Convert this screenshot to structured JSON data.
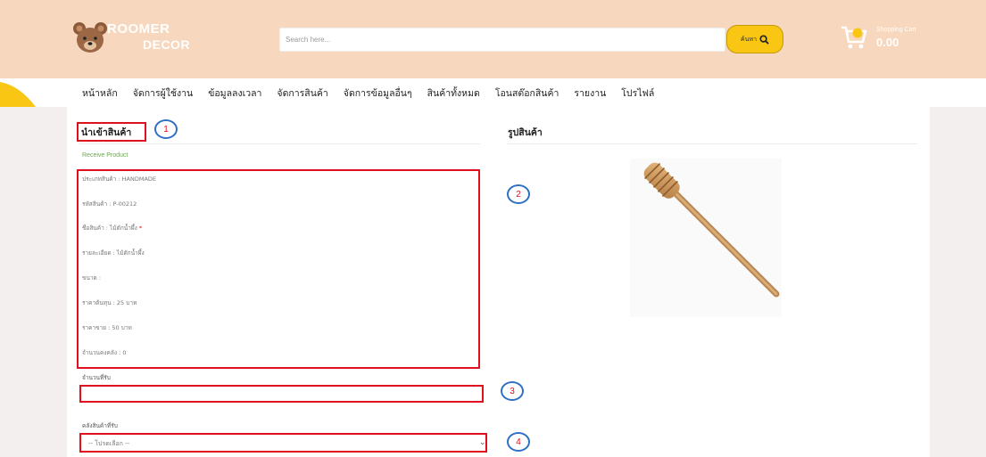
{
  "brand": {
    "line1": "ROOMER",
    "line2": "DECOR"
  },
  "search": {
    "placeholder": "Search here...",
    "button_label": "ค้นหา"
  },
  "cart": {
    "label": "Shopping Cart",
    "value": "0.00"
  },
  "nav": {
    "items": [
      "หน้าหลัก",
      "จัดการผู้ใช้งาน",
      "ข้อมูลลงเวลา",
      "จัดการสินค้า",
      "จัดการข้อมูลอื่นๆ",
      "สินค้าทั้งหมด",
      "โอนสต๊อกสินค้า",
      "รายงาน",
      "โปรไฟล์"
    ]
  },
  "section": {
    "title": "นำเข้าสินค้า",
    "subtitle": "Receive Product",
    "image_title": "รูปสินค้า"
  },
  "fields": [
    {
      "label": "ประเภทสินค้า : HANDMADE"
    },
    {
      "label": "รหัสสินค้า : P-00212"
    },
    {
      "label": "ชื่อสินค้า : ไม้ตักน้ำผึ้ง",
      "required": true
    },
    {
      "label": "รายละเอียด : ไม้ตักน้ำผึ้ง"
    },
    {
      "label": "ขนาด :"
    },
    {
      "label": "ราคาต้นทุน : 25 บาท"
    },
    {
      "label": "ราคาขาย : 50 บาท"
    },
    {
      "label": "จำนวนคงคลัง : 0"
    }
  ],
  "required_mark": "*",
  "form": {
    "quantity_label": "จำนวนที่รับ",
    "quantity_value": "",
    "warehouse_label": "คลังสินค้าที่รับ",
    "warehouse_selected": "-- โปรดเลือก --"
  },
  "annotations": [
    "1",
    "2",
    "3",
    "4"
  ],
  "colors": {
    "header_bg": "#f7d7bd",
    "accent_yellow": "#f9c613",
    "annotation_red": "#e0101e",
    "annotation_blue": "#2f6fc4",
    "subtitle_green": "#6aa84f"
  }
}
